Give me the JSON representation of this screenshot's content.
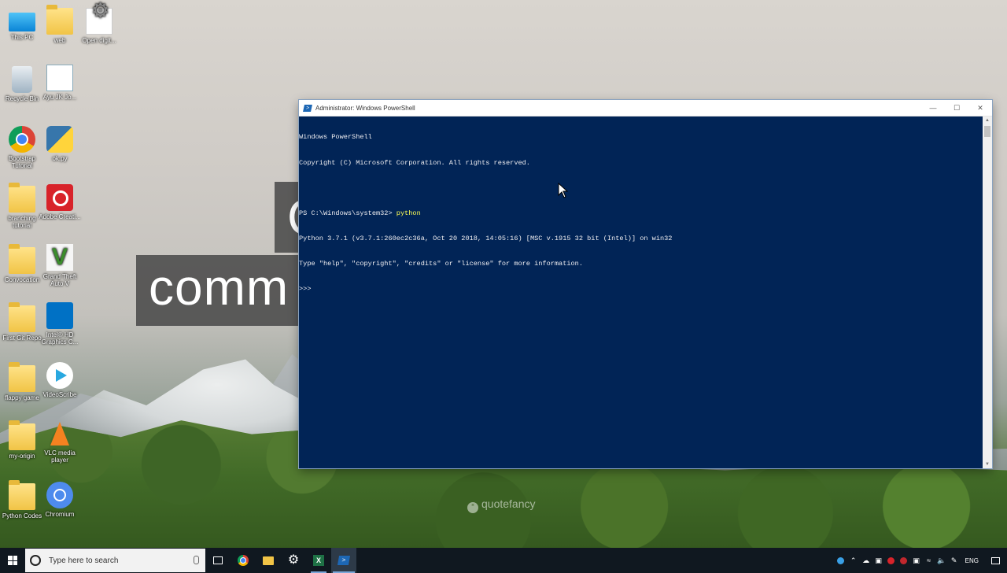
{
  "desktop": {
    "icons": [
      {
        "label": "This PC",
        "icon": "this-pc-icon"
      },
      {
        "label": "web",
        "icon": "folder-icon"
      },
      {
        "label": "Open digit...",
        "icon": "open-digit-icon"
      },
      {
        "label": "Recycle Bin",
        "icon": "recycle-bin-icon"
      },
      {
        "label": "Ayu JK Jo...",
        "icon": "document-icon"
      },
      {
        "label": "Bootstrap Tutorial",
        "icon": "chrome-icon"
      },
      {
        "label": "ok.py",
        "icon": "python-file-icon"
      },
      {
        "label": "branching tutorial",
        "icon": "folder-icon"
      },
      {
        "label": "Adobe Creati...",
        "icon": "adobe-creative-cloud-icon"
      },
      {
        "label": "Convocation",
        "icon": "folder-icon"
      },
      {
        "label": "Grand Theft Auto V",
        "icon": "gta-v-icon"
      },
      {
        "label": "First Git Repo",
        "icon": "folder-icon"
      },
      {
        "label": "Intel® HD Graphics C...",
        "icon": "intel-graphics-icon"
      },
      {
        "label": "flappy game",
        "icon": "folder-icon"
      },
      {
        "label": "VideoScribe",
        "icon": "videoscribe-icon"
      },
      {
        "label": "my-origin",
        "icon": "folder-icon"
      },
      {
        "label": "VLC media player",
        "icon": "vlc-icon"
      },
      {
        "label": "Python Codes",
        "icon": "folder-icon"
      },
      {
        "label": "Chromium",
        "icon": "chromium-icon"
      }
    ]
  },
  "wallpaper": {
    "word_partial": "comm",
    "word_partial_top": "C",
    "watermark": "quotefancy"
  },
  "powershell": {
    "title": "Administrator: Windows PowerShell",
    "lines": {
      "l1": "Windows PowerShell",
      "l2": "Copyright (C) Microsoft Corporation. All rights reserved.",
      "l3": "",
      "l4_prompt": "PS C:\\Windows\\system32> ",
      "l4_cmd": "python",
      "l5": "Python 3.7.1 (v3.7.1:260ec2c36a, Oct 20 2018, 14:05:16) [MSC v.1915 32 bit (Intel)] on win32",
      "l6": "Type \"help\", \"copyright\", \"credits\" or \"license\" for more information.",
      "l7": ">>> "
    },
    "colors": {
      "background": "#012456",
      "text": "#eeedf0",
      "command": "#ffff55"
    }
  },
  "taskbar": {
    "search_placeholder": "Type here to search",
    "apps": [
      {
        "icon": "task-view-icon"
      },
      {
        "icon": "chrome-icon"
      },
      {
        "icon": "file-explorer-icon"
      },
      {
        "icon": "settings-icon"
      },
      {
        "icon": "excel-icon"
      },
      {
        "icon": "powershell-icon",
        "active": true
      }
    ],
    "tray": {
      "language": "ENG"
    }
  }
}
